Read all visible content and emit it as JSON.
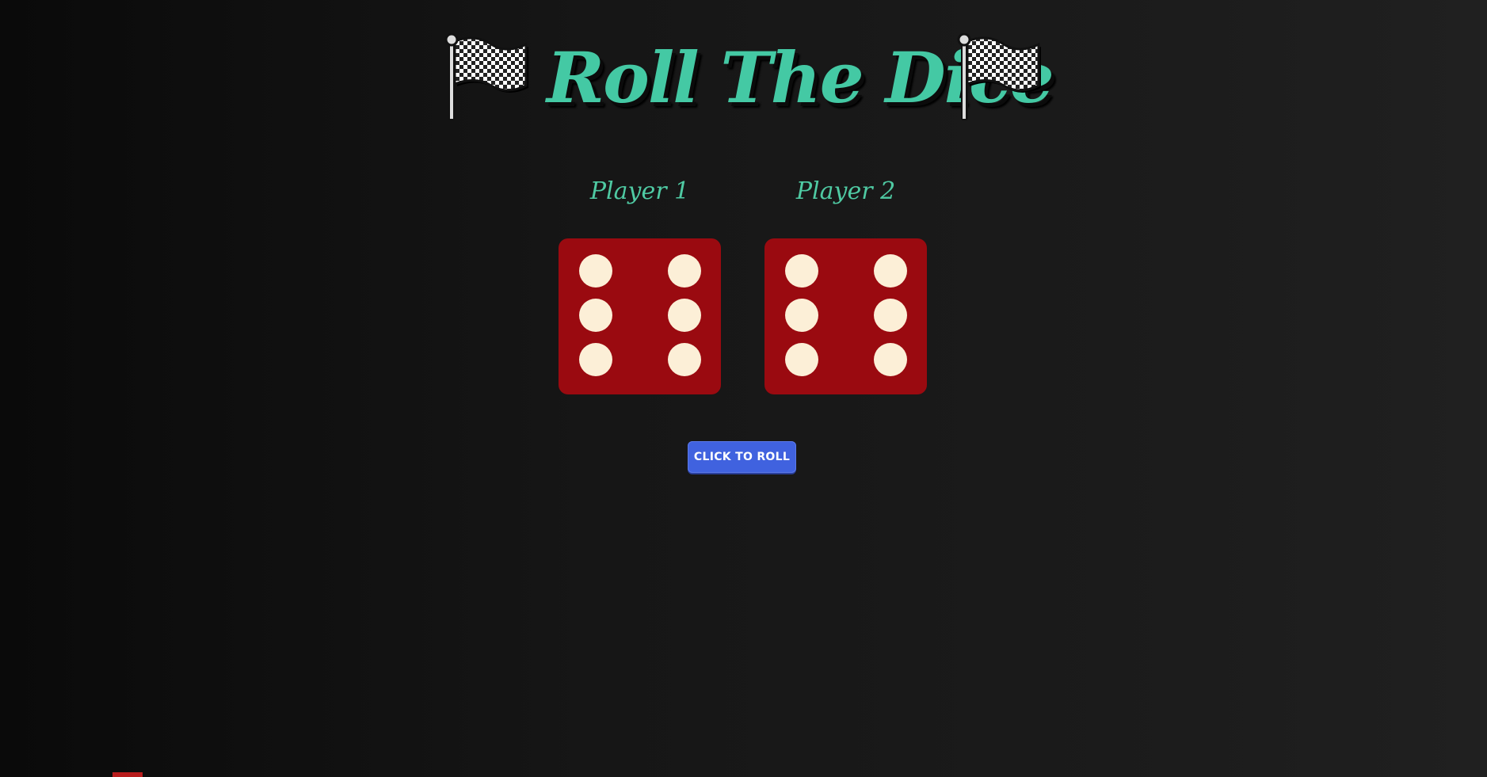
{
  "header": {
    "title": "Roll The Dice",
    "left_icon": "checkered-flag-icon",
    "right_icon": "checkered-flag-icon"
  },
  "players": [
    {
      "label": "Player 1",
      "die_value": 6
    },
    {
      "label": "Player 2",
      "die_value": 6
    }
  ],
  "controls": {
    "roll_button_label": "CLICK TO ROLL"
  },
  "colors": {
    "title": "#44c9a4",
    "player_label": "#4fcaa3",
    "die_face": "#9a0a10",
    "pip": "#fcefd7",
    "button": "#4062df"
  }
}
